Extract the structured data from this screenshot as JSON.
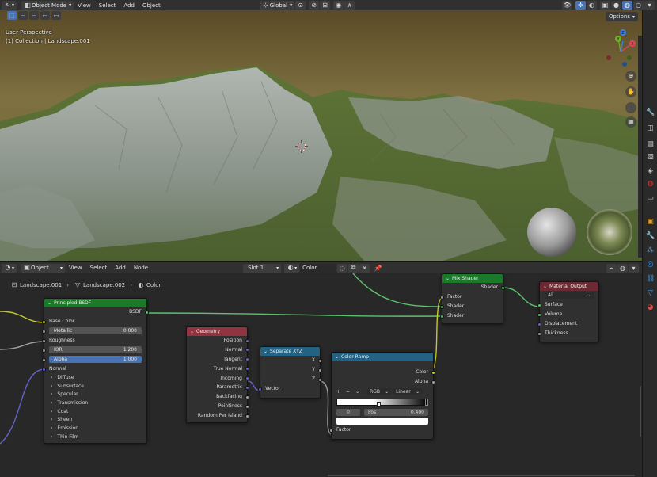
{
  "header": {
    "mode": "Object Mode",
    "menus": [
      "View",
      "Select",
      "Add",
      "Object"
    ],
    "orientation": "Global"
  },
  "viewport": {
    "info_line1": "User Perspective",
    "info_line2": "(1) Collection | Landscape.001",
    "options_label": "Options",
    "gizmo_axes": [
      "X",
      "Y",
      "Z"
    ]
  },
  "node_editor": {
    "editor_type": "Object",
    "menus": [
      "View",
      "Select",
      "Add",
      "Node"
    ],
    "slot": "Slot 1",
    "material": "Color",
    "breadcrumb": [
      "Landscape.001",
      "Landscape.002",
      "Color"
    ]
  },
  "nodes": {
    "principled": {
      "title": "Principled BSDF",
      "output": "BSDF",
      "base_color": "Base Color",
      "metallic_label": "Metallic",
      "metallic_value": "0.000",
      "roughness": "Roughness",
      "ior_label": "IOR",
      "ior_value": "1.200",
      "alpha_label": "Alpha",
      "alpha_value": "1.000",
      "normal": "Normal",
      "panels": [
        "Diffuse",
        "Subsurface",
        "Specular",
        "Transmission",
        "Coat",
        "Sheen",
        "Emission",
        "Thin Film"
      ]
    },
    "geometry": {
      "title": "Geometry",
      "outputs": [
        "Position",
        "Normal",
        "Tangent",
        "True Normal",
        "Incoming",
        "Parametric",
        "Backfacing",
        "Pointiness",
        "Random Per Island"
      ]
    },
    "separate_xyz": {
      "title": "Separate XYZ",
      "outputs": [
        "X",
        "Y",
        "Z"
      ],
      "input": "Vector"
    },
    "color_ramp": {
      "title": "Color Ramp",
      "out_color": "Color",
      "out_alpha": "Alpha",
      "color_mode": "RGB",
      "interpolation": "Linear",
      "stop_index": "0",
      "pos_label": "Pos",
      "pos_value": "0.400",
      "input": "Factor"
    },
    "mix_shader": {
      "title": "Mix Shader",
      "output": "Shader",
      "inputs": [
        "Factor",
        "Shader",
        "Shader"
      ]
    },
    "material_output": {
      "title": "Material Output",
      "target": "All",
      "inputs": [
        "Surface",
        "Volume",
        "Displacement",
        "Thickness"
      ]
    }
  },
  "colors": {
    "shader_header": "#1b7a2a",
    "geometry_header": "#913441",
    "converter_header": "#246283",
    "output_header": "#6b2a33",
    "shader_socket": "#5cc26d",
    "color_socket": "#c7c729",
    "float_socket": "#a1a1a1",
    "vector_socket": "#6363c7",
    "accent": "#4772b3"
  }
}
